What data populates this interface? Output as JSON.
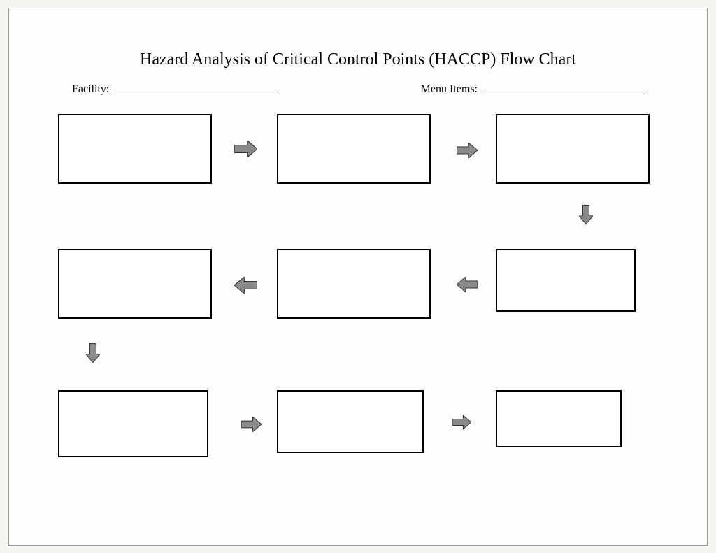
{
  "title": "Hazard Analysis of Critical Control Points (HACCP) Flow Chart",
  "fields": {
    "facility_label": "Facility:",
    "facility_value": "",
    "menu_items_label": "Menu Items:",
    "menu_items_value": ""
  },
  "boxes": {
    "r1c1": "",
    "r1c2": "",
    "r1c3": "",
    "r2c1": "",
    "r2c2": "",
    "r2c3": "",
    "r3c1": "",
    "r3c2": "",
    "r3c3": ""
  }
}
